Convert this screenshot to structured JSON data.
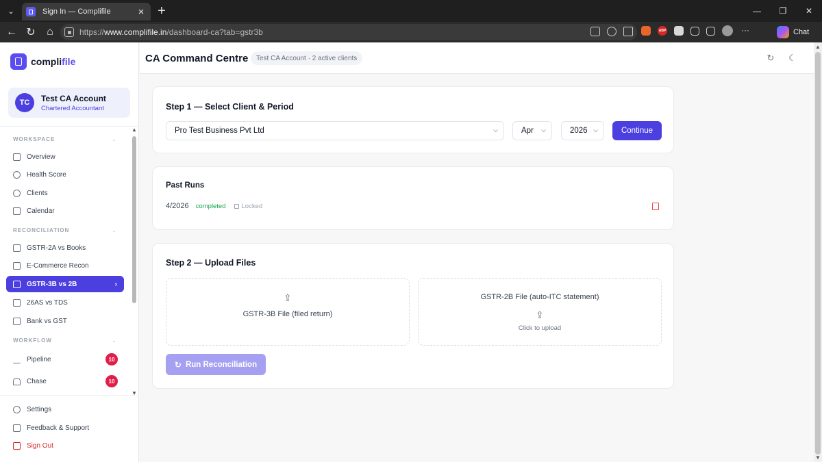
{
  "browser": {
    "tab_title": "Sign In — Complifile",
    "url_prefix": "https://",
    "url_host": "www.complifile.in",
    "url_path": "/dashboard-ca?tab=gstr3b",
    "chat_label": "Chat",
    "ext_abp_label": "ABP"
  },
  "brand": {
    "name_part1": "compli",
    "name_part2": "file",
    "accent_color": "#5b4cf0"
  },
  "account": {
    "initials": "TC",
    "name": "Test CA Account",
    "role": "Chartered Accountant"
  },
  "sidebar": {
    "workspace_label": "WORKSPACE",
    "workspace_items": [
      {
        "label": "Overview",
        "icon": "grid-icon"
      },
      {
        "label": "Health Score",
        "icon": "pulse-icon"
      },
      {
        "label": "Clients",
        "icon": "users-icon"
      },
      {
        "label": "Calendar",
        "icon": "calendar-icon"
      }
    ],
    "reconciliation_label": "RECONCILIATION",
    "reconciliation_items": [
      {
        "label": "GSTR-2A vs Books",
        "icon": "compare-icon"
      },
      {
        "label": "E-Commerce Recon",
        "icon": "cart-icon"
      },
      {
        "label": "GSTR-3B vs 2B",
        "icon": "compare-icon",
        "active": true
      },
      {
        "label": "26AS vs TDS",
        "icon": "document-icon"
      },
      {
        "label": "Bank vs GST",
        "icon": "bank-icon"
      }
    ],
    "workflow_label": "WORKFLOW",
    "workflow_items": [
      {
        "label": "Pipeline",
        "icon": "trend-icon",
        "badge": "10"
      },
      {
        "label": "Chase",
        "icon": "bell-icon",
        "badge": "10"
      }
    ],
    "bottom_items": [
      {
        "label": "Settings",
        "icon": "gear-icon"
      },
      {
        "label": "Feedback & Support",
        "icon": "message-icon"
      },
      {
        "label": "Sign Out",
        "icon": "logout-icon"
      }
    ]
  },
  "header": {
    "title": "CA Command Centre",
    "subtitle": "Test CA Account · 2 active clients"
  },
  "step1": {
    "title": "Step 1 — Select Client & Period",
    "client": "Pro Test Business Pvt Ltd",
    "month": "Apr",
    "year": "2026",
    "continue_label": "Continue"
  },
  "past_runs": {
    "title": "Past Runs",
    "runs": [
      {
        "period": "4/2026",
        "status": "completed",
        "lock": "Locked"
      }
    ]
  },
  "step2": {
    "title": "Step 2 — Upload Files",
    "file1_label": "GSTR-3B File (filed return)",
    "file2_label": "GSTR-2B File (auto-ITC statement)",
    "file2_hint": "Click to upload",
    "run_label": "Run Reconciliation"
  },
  "colors": {
    "primary": "#4c3fe0",
    "success": "#16a34a",
    "danger": "#dc2626",
    "badge": "#e11d48"
  }
}
